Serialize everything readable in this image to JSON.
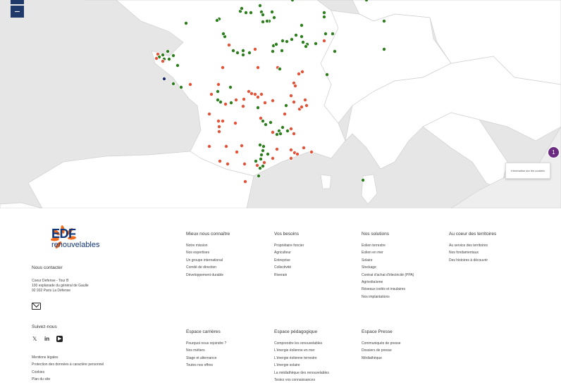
{
  "map": {
    "zoom_out_label": "−",
    "cluster_count": "1",
    "cookie_text": "Information sur les cookies",
    "colors": {
      "green": "#2e7d1e",
      "orange": "#e2533a",
      "navy": "#1a2b6d",
      "purple": "#6b2b80",
      "land": "#ffffff",
      "sea": "#e6e6e6"
    }
  },
  "footer": {
    "logo_word": "EDF",
    "logo_sub": "renouvelables",
    "contact_title": "Nous contacter",
    "address": [
      "Coeur Defense - Tour B",
      "100 esplanade du général de Gaulle",
      "92 932 Paris La Défense"
    ],
    "follow_title": "Suivez-nous",
    "social_icons": [
      "x-icon",
      "linkedin-icon",
      "youtube-icon"
    ],
    "social_glyphs": [
      "𝕏",
      "in",
      "▶"
    ],
    "legal_links": [
      "Mentions légales",
      "Protection des données à caractère personnel",
      "Cookies",
      "Plan du site"
    ],
    "columns_top": [
      {
        "title": "Mieux nous connaître",
        "items": [
          "Notre mission",
          "Nos expertises",
          "Un groupe international",
          "Comité de direction",
          "Développement durable"
        ]
      },
      {
        "title": "Vos besoins",
        "items": [
          "Propriétaire foncier",
          "Agriculteur",
          "Entreprise",
          "Collectivité",
          "Riverain"
        ]
      },
      {
        "title": "Nos solutions",
        "items": [
          "Eolien terrestre",
          "Eolien en mer",
          "Solaire",
          "Stockage",
          "Contrat d'achat d'électricité (PPA)",
          "Agrivoltaïsme",
          "Réseaux isolés et insulaires",
          "Nos implantations"
        ]
      },
      {
        "title": "Au coeur des territoires",
        "items": [
          "Au service des territoires",
          "Nos fondamentaux",
          "Des histoires à découvrir"
        ]
      }
    ],
    "columns_bottom": [
      {
        "title": "Espace carrières",
        "items": [
          "Pourquoi nous rejoindre ?",
          "Nos métiers",
          "Stage et alternance",
          "Toutes nos offres"
        ]
      },
      {
        "title": "Espace pédagogique",
        "items": [
          "Comprendre les renouvelables",
          "L'énergie éolienne en mer",
          "L'énergie éolienne terrestre",
          "L'énergie solaire",
          "La médiathèque des renouvelables",
          "Testez vos connaissances"
        ]
      },
      {
        "title": "Espace Presse",
        "items": [
          "Communiqués de presse",
          "Dossiers de presse",
          "Médiathèque"
        ]
      }
    ]
  }
}
